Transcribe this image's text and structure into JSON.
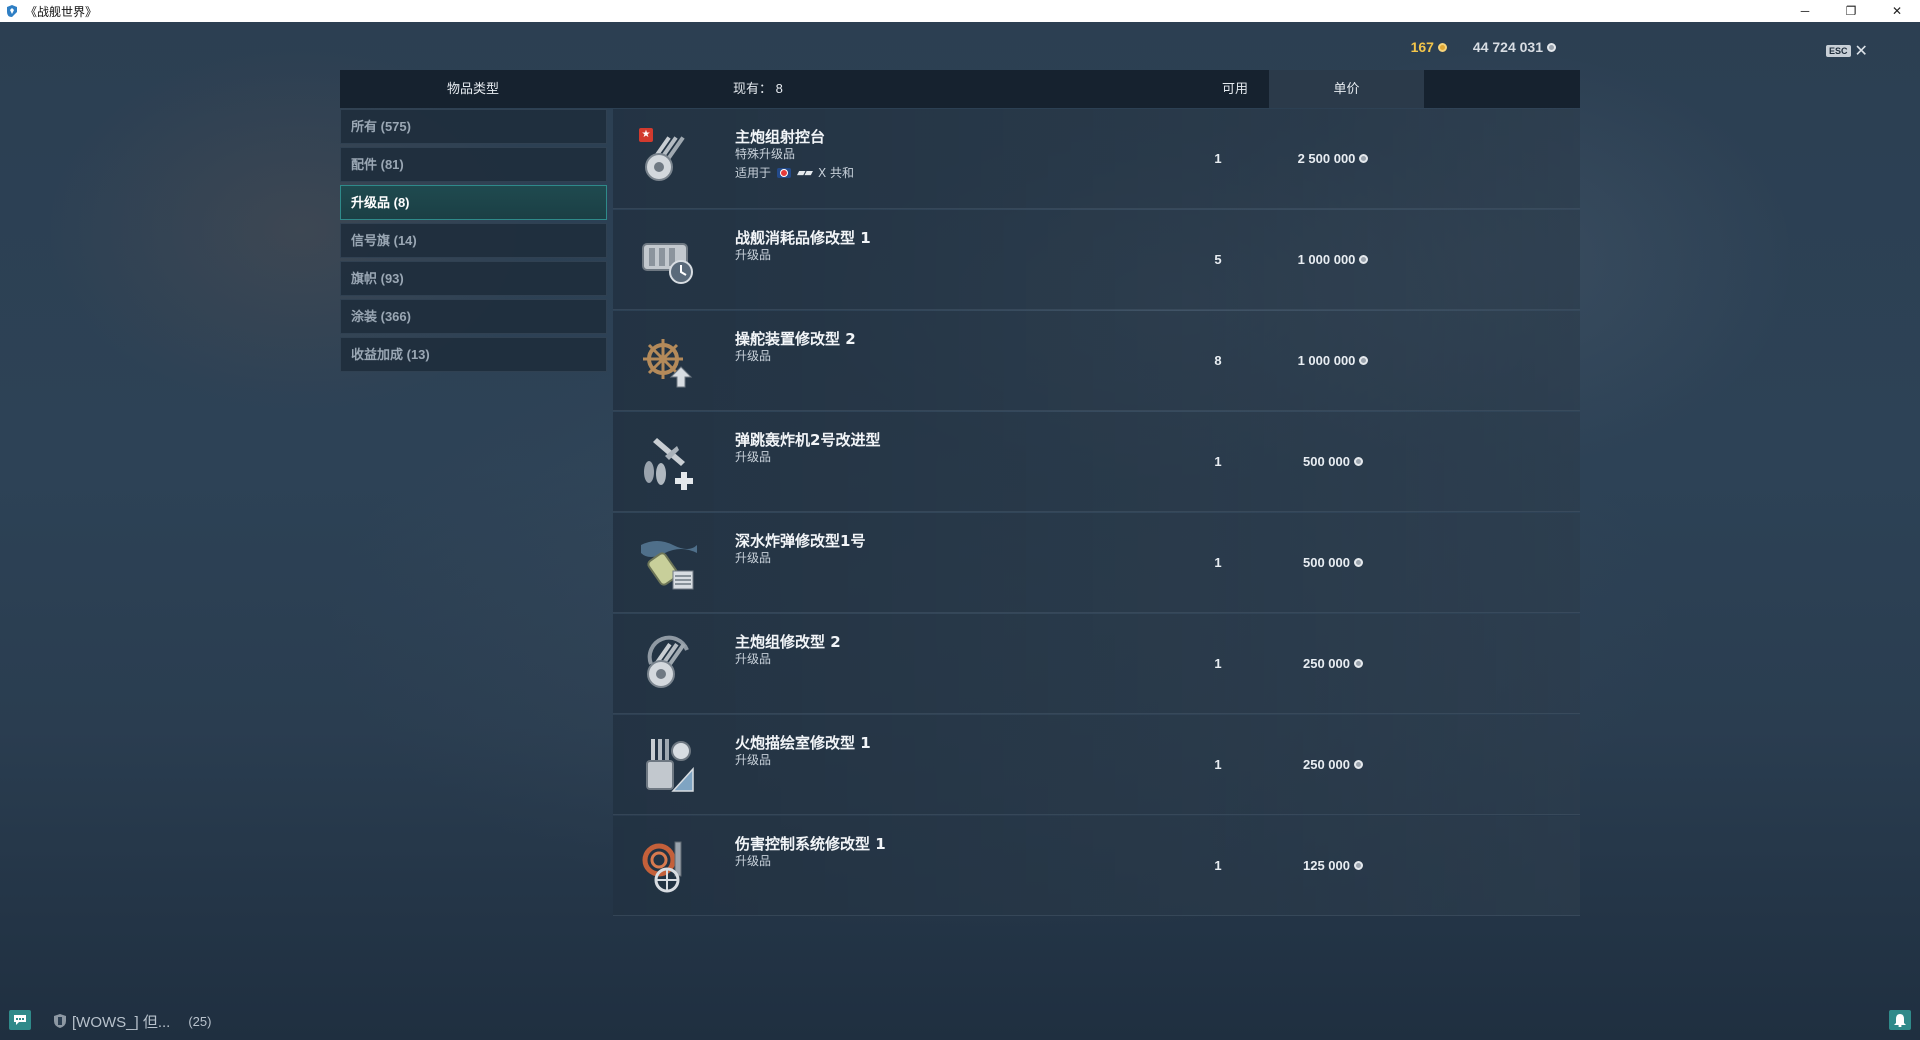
{
  "window": {
    "title": "《战舰世界》",
    "icon": "app-icon",
    "minimize_glyph": "─",
    "restore_glyph": "❐",
    "close_glyph": "✕"
  },
  "currency": {
    "doubloons": "167",
    "credits": "44 724 031",
    "gold_color": "#f3c54a"
  },
  "esc": {
    "label": "ESC",
    "close_glyph": "✕"
  },
  "header": {
    "type": "物品类型",
    "owned": "现有：  8",
    "available": "可用",
    "price": "单价"
  },
  "categories": [
    {
      "label": "所有 (575)",
      "active": false
    },
    {
      "label": "配件 (81)",
      "active": false
    },
    {
      "label": "升级品 (8)",
      "active": true
    },
    {
      "label": "信号旗 (14)",
      "active": false
    },
    {
      "label": "旗帜 (93)",
      "active": false
    },
    {
      "label": "涂装 (366)",
      "active": false
    },
    {
      "label": "收益加成 (13)",
      "active": false
    }
  ],
  "items": [
    {
      "name": "主炮组射控台",
      "sub": "特殊升级品",
      "applies_label": "适用于",
      "applies_tier": "X 共和",
      "available": "1",
      "price": "2 500 000",
      "icon": "main-battery-fire-control-icon"
    },
    {
      "name": "战舰消耗品修改型 1",
      "sub": "升级品",
      "available": "5",
      "price": "1 000 000",
      "icon": "consumables-mod-icon"
    },
    {
      "name": "操舵装置修改型 2",
      "sub": "升级品",
      "available": "8",
      "price": "1 000 000",
      "icon": "steering-gear-icon"
    },
    {
      "name": "弹跳轰炸机2号改进型",
      "sub": "升级品",
      "available": "1",
      "price": "500 000",
      "icon": "skip-bomber-icon"
    },
    {
      "name": "深水炸弹修改型1号",
      "sub": "升级品",
      "available": "1",
      "price": "500 000",
      "icon": "depth-charge-icon"
    },
    {
      "name": "主炮组修改型 2",
      "sub": "升级品",
      "available": "1",
      "price": "250 000",
      "icon": "main-battery-mod-icon"
    },
    {
      "name": "火炮描绘室修改型 1",
      "sub": "升级品",
      "available": "1",
      "price": "250 000",
      "icon": "gun-fire-control-icon"
    },
    {
      "name": "伤害控制系统修改型 1",
      "sub": "升级品",
      "available": "1",
      "price": "125 000",
      "icon": "damage-control-icon"
    }
  ],
  "bottom": {
    "clan": "[WOWS_]  但...",
    "count": "(25)"
  }
}
